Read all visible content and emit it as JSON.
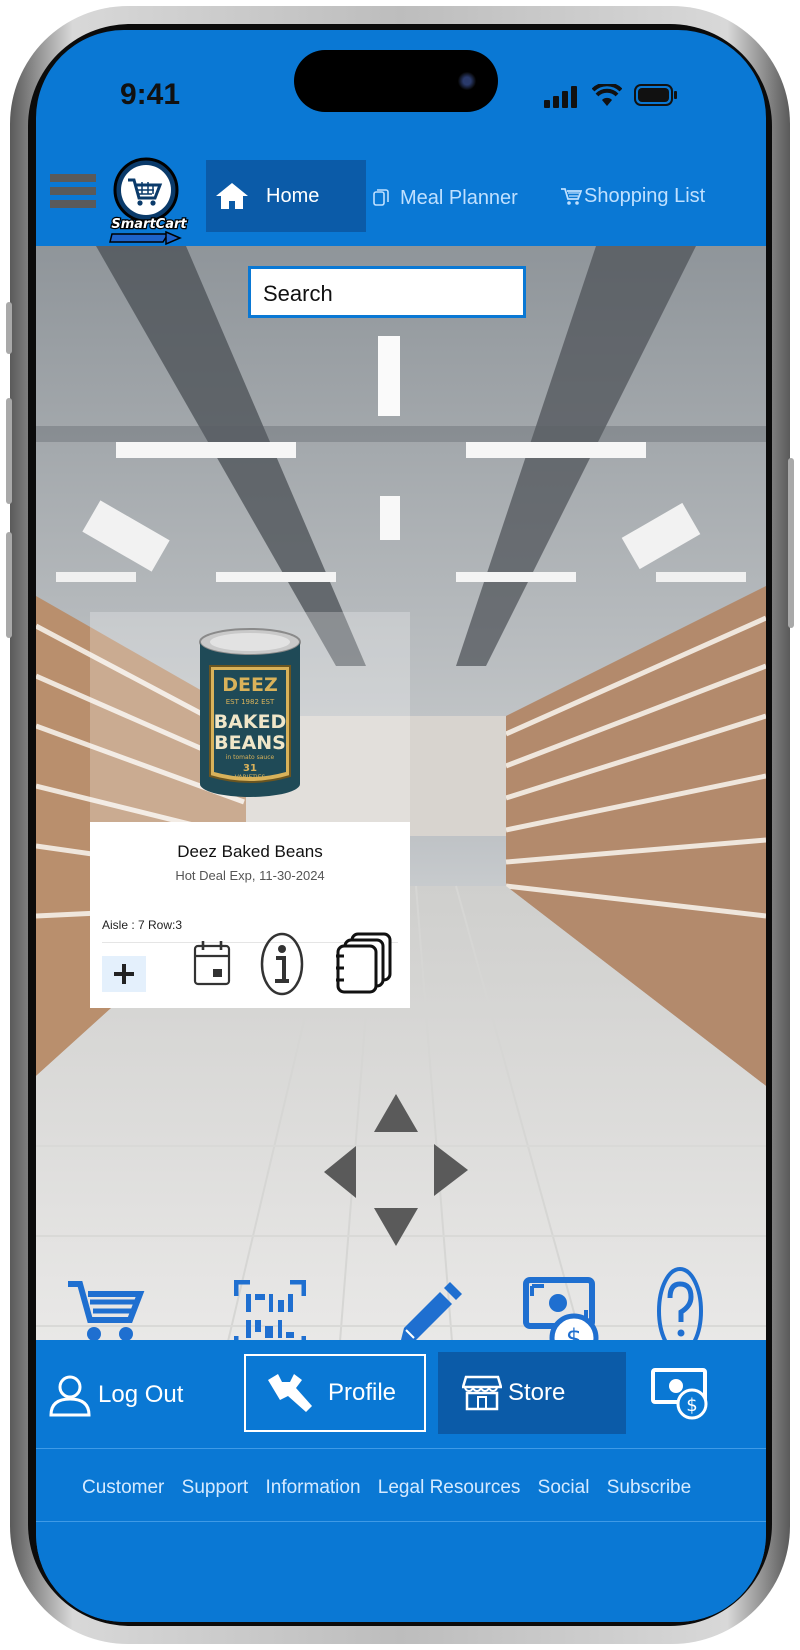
{
  "status_bar": {
    "time": "9:41"
  },
  "app": {
    "logo_text": "SmartCart"
  },
  "nav": {
    "tabs": [
      {
        "label": "Home",
        "icon": "home-icon",
        "active": true
      },
      {
        "label": "Meal Planner",
        "icon": "notes-icon",
        "active": false
      },
      {
        "label": "Shopping List",
        "icon": "cart-icon",
        "active": false
      }
    ]
  },
  "search": {
    "value": "Search"
  },
  "product": {
    "name": "Deez Baked Beans",
    "deal": "Hot Deal Exp, 11-30-2024",
    "location": "Aisle : 7 Row:3",
    "can_label": {
      "brand": "DEEZ",
      "est": "EST 1982 EST",
      "line1": "BAKED",
      "line2": "BEANS",
      "sub": "in tomato sauce",
      "count": "31",
      "varieties": "VARIETIES"
    }
  },
  "toolbar_icons": [
    "cart-icon",
    "barcode-scan-icon",
    "pencil-icon",
    "money-icon",
    "help-icon"
  ],
  "bottom_bar": {
    "logout": "Log Out",
    "profile": "Profile",
    "store": "Store"
  },
  "footer": {
    "links": [
      "Customer",
      "Support",
      "Information",
      "Legal Resources",
      "Social",
      "Subscribe"
    ]
  },
  "colors": {
    "brand_blue": "#0a78d4",
    "active_tab": "#0b5ba8",
    "icon_blue": "#1f6fd0"
  }
}
